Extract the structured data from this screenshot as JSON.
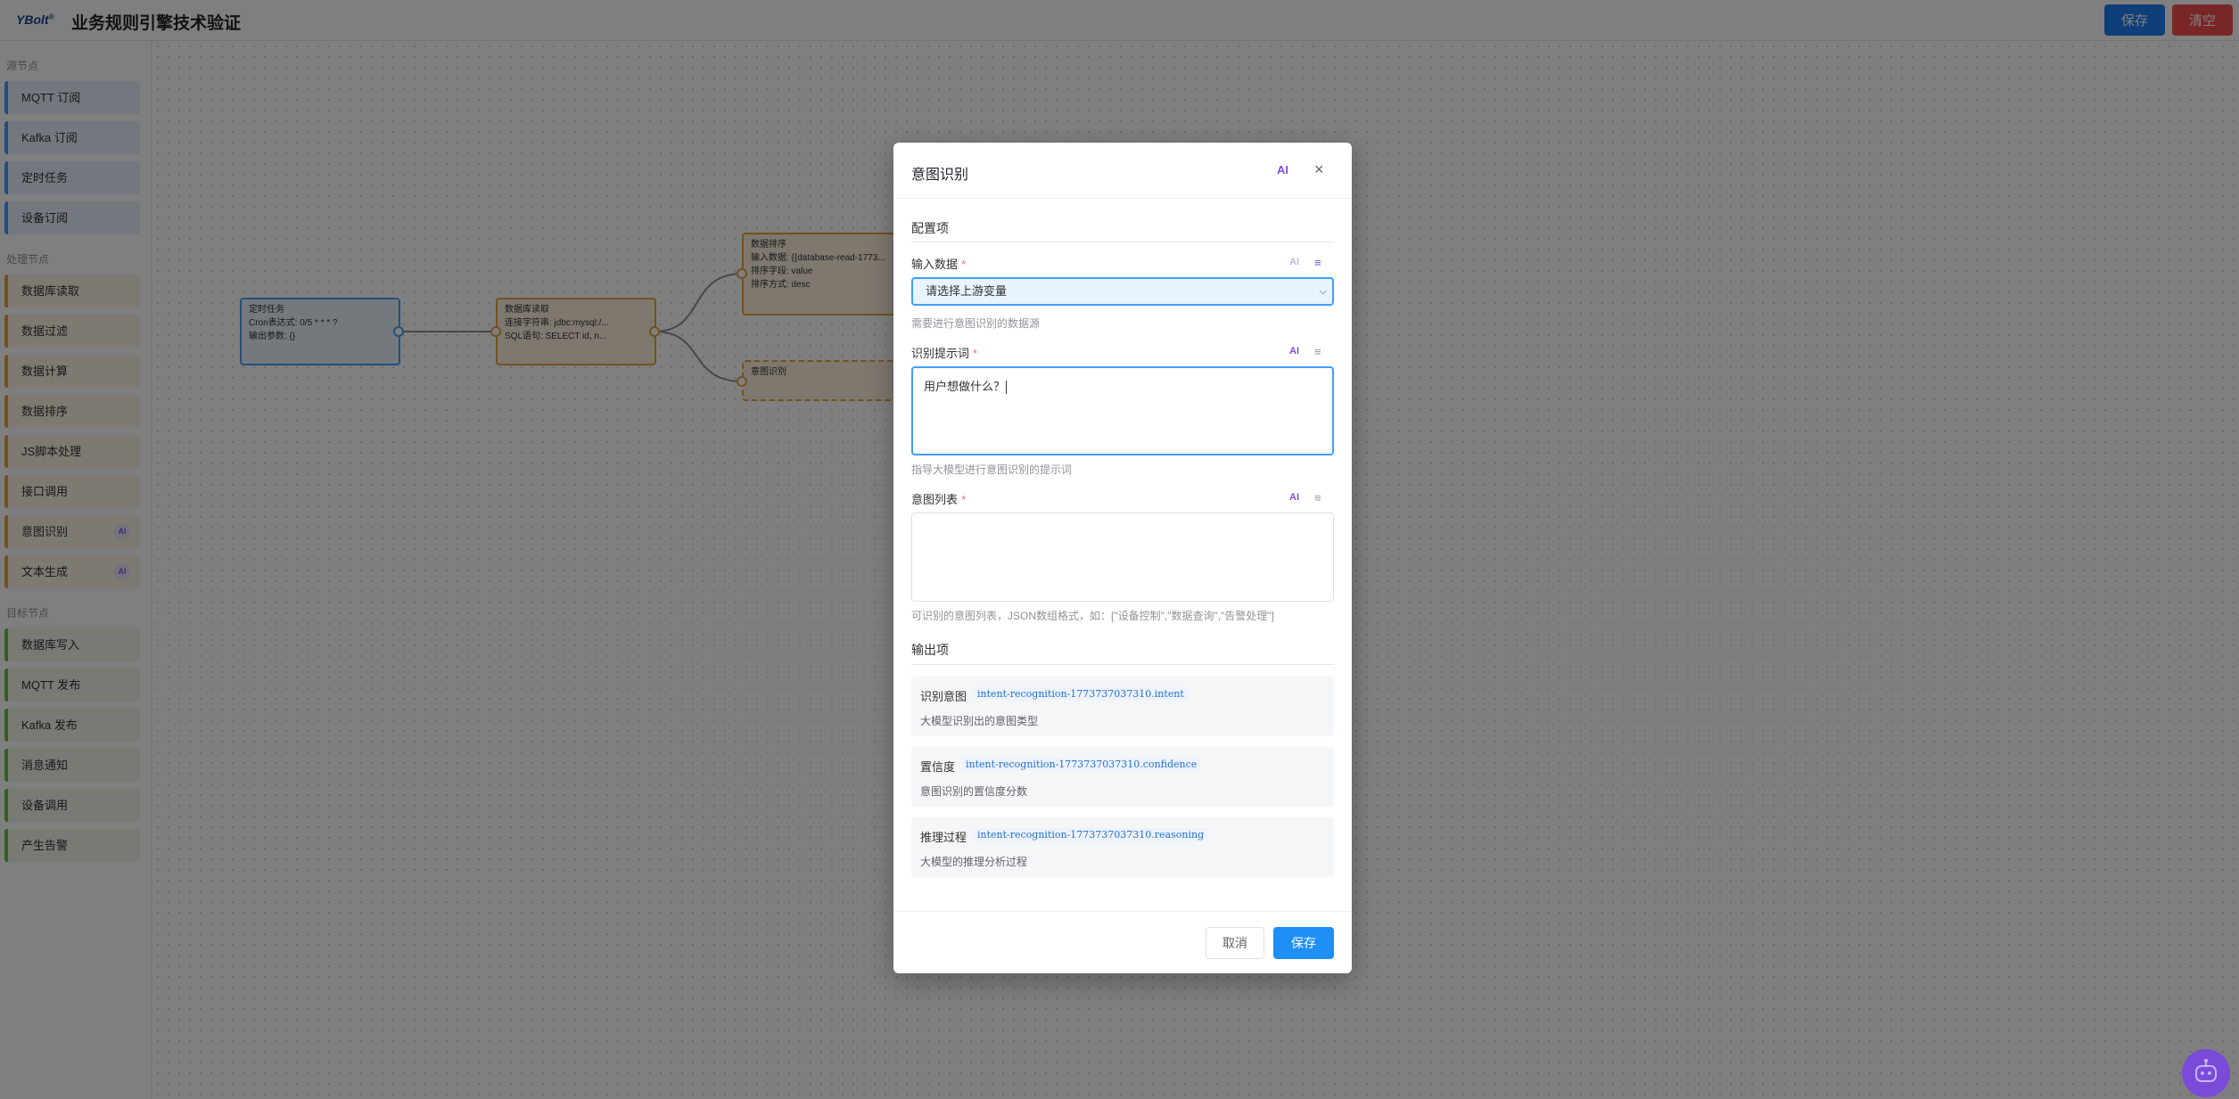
{
  "header": {
    "logo": "YBolt",
    "logo_mark": "®",
    "title": "业务规则引擎技术验证",
    "save_label": "保存",
    "clear_label": "清空"
  },
  "sidebar": {
    "source_title": "源节点",
    "source_items": [
      "MQTT 订阅",
      "Kafka 订阅",
      "定时任务",
      "设备订阅"
    ],
    "process_title": "处理节点",
    "process_items": [
      "数据库读取",
      "数据过滤",
      "数据计算",
      "数据排序",
      "JS脚本处理",
      "接口调用",
      "意图识别",
      "文本生成"
    ],
    "ai_badge": "AI",
    "target_title": "目标节点",
    "target_items": [
      "数据库写入",
      "MQTT 发布",
      "Kafka 发布",
      "消息通知",
      "设备调用",
      "产生告警"
    ]
  },
  "canvas": {
    "nodes": [
      {
        "title": "定时任务",
        "lines": [
          "Cron表达式: 0/5 * * * ?",
          "输出参数: {}"
        ]
      },
      {
        "title": "数据库读取",
        "lines": [
          "连接字符串: jdbc:mysql:/...",
          "SQL语句: SELECT id, n..."
        ]
      },
      {
        "title": "数据排序",
        "lines": [
          "输入数据: {{database-read-1773...",
          "排序字段: value",
          "排序方式: desc"
        ]
      },
      {
        "title": "意图识别",
        "lines": []
      }
    ]
  },
  "dialog": {
    "title": "意图识别",
    "ai_label": "AI",
    "close_icon": "×",
    "config_section": "配置项",
    "input_label": "输入数据",
    "input_select_value": "请选择上游变量",
    "input_hint": "需要进行意图识别的数据源",
    "prompt_label": "识别提示词",
    "prompt_value": "用户想做什么？",
    "prompt_hint": "指导大模型进行意图识别的提示词",
    "intents_label": "意图列表",
    "intents_value": "",
    "intents_hint": "可识别的意图列表，JSON数组格式，如：[\"设备控制\",\"数据查询\",\"告警处理\"]",
    "ai_tool": "AI",
    "required_mark": "*",
    "output_section": "输出项",
    "outputs": [
      {
        "name": "识别意图",
        "code": "intent-recognition-1773737037310.intent",
        "desc": "大模型识别出的意图类型"
      },
      {
        "name": "置信度",
        "code": "intent-recognition-1773737037310.confidence",
        "desc": "意图识别的置信度分数"
      },
      {
        "name": "推理过程",
        "code": "intent-recognition-1773737037310.reasoning",
        "desc": "大模型的推理分析过程"
      }
    ],
    "cancel_label": "取消",
    "save_label": "保存"
  },
  "colors": {
    "primary": "#1f8ff5",
    "danger": "#f24c4c",
    "ai_purple": "#7b4de0",
    "source": "#409eff",
    "process": "#e6a23c",
    "target": "#67c23a"
  }
}
